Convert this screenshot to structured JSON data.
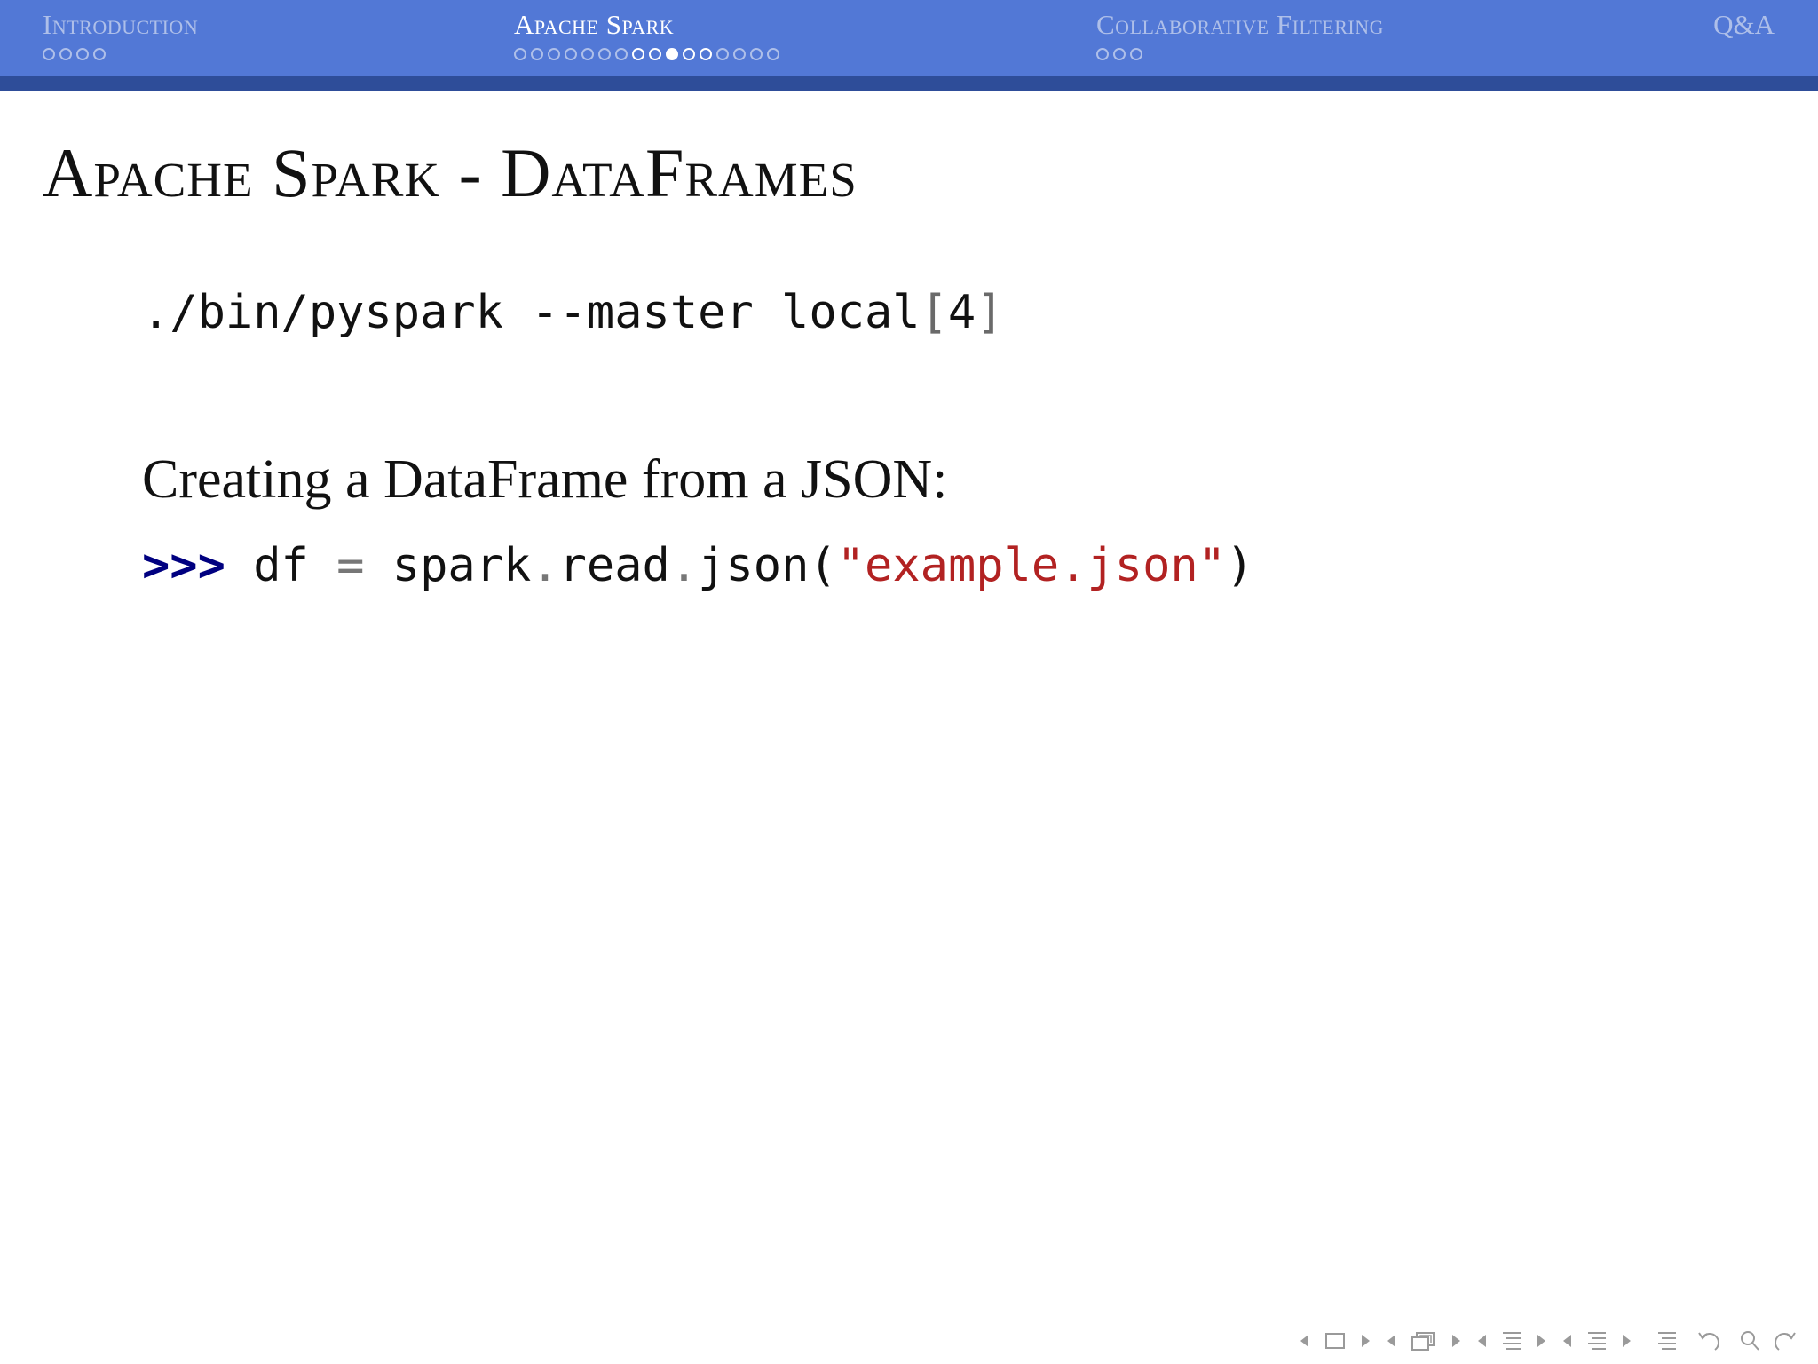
{
  "nav_header": {
    "sections": [
      {
        "title": "Introduction",
        "dots": 4,
        "current": -1
      },
      {
        "title": "Apache Spark",
        "dots": 16,
        "current": 9
      },
      {
        "title": "Collaborative Filtering",
        "dots": 3,
        "current": -1
      }
    ],
    "qa_label": "Q&A"
  },
  "slide": {
    "title": "Apache Spark - DataFrames",
    "command": {
      "prefix": "./bin/pyspark --master local",
      "bracket_open": "[",
      "arg": "4",
      "bracket_close": "]"
    },
    "text": "Creating a DataFrame from a JSON:",
    "code": {
      "prompt": ">>>",
      "var": " df ",
      "eq": "=",
      "obj": " spark",
      "dot1": ".",
      "method1": "read",
      "dot2": ".",
      "method2": "json(",
      "string": "\"example.json\"",
      "close": ")"
    }
  },
  "navigation_icons": [
    "arrow-left-icon",
    "frame-icon",
    "arrow-right-icon",
    "arrow-left-icon",
    "subsection-icon",
    "arrow-right-icon",
    "arrow-left-icon",
    "section-icon",
    "arrow-right-icon",
    "arrow-left-icon",
    "subsection-list-icon",
    "arrow-right-icon",
    "align-icon",
    "undo-icon",
    "search-icon",
    "redo-icon"
  ]
}
